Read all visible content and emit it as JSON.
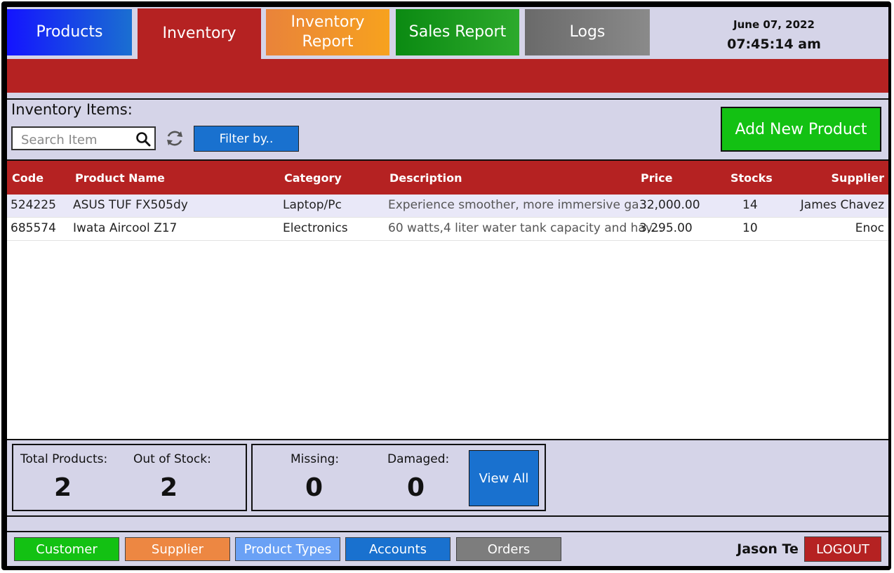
{
  "tabs": [
    {
      "label": "Products"
    },
    {
      "label": "Inventory"
    },
    {
      "label_line1": "Inventory",
      "label_line2": "Report"
    },
    {
      "label": "Sales Report"
    },
    {
      "label": "Logs"
    }
  ],
  "active_tab": "Inventory",
  "clock": {
    "date": "June 07, 2022",
    "time": "07:45:14 am"
  },
  "inventory": {
    "title": "Inventory Items:",
    "search_placeholder": "Search Item",
    "filter_label": "Filter by..",
    "add_label": "Add New Product"
  },
  "table": {
    "columns": [
      "Code",
      "Product Name",
      "Category",
      "Description",
      "Price",
      "Stocks",
      "Supplier"
    ],
    "rows": [
      [
        "524225",
        "ASUS TUF FX505dy",
        "Laptop/Pc",
        "Experience smoother, more immersive ga...",
        "32,000.00",
        "14",
        "James Chavez"
      ],
      [
        "685574",
        "Iwata Aircool Z17",
        "Electronics",
        "60 watts,4 liter water tank capacity and hav...",
        "3,295.00",
        "10",
        "Enoc"
      ]
    ]
  },
  "stats": {
    "total_products_label": "Total Products:",
    "total_products": "2",
    "out_of_stock_label": "Out of Stock:",
    "out_of_stock": "2",
    "missing_label": "Missing:",
    "missing": "0",
    "damaged_label": "Damaged:",
    "damaged": "0",
    "view_all_label": "View All"
  },
  "footer": {
    "buttons": [
      "Customer",
      "Supplier",
      "Product Types",
      "Accounts",
      "Orders"
    ],
    "user": "Jason Te",
    "logout": "LOGOUT"
  },
  "colors": {
    "accent_red": "#b52222",
    "panel_bg": "#d5d4e8",
    "button_blue": "#1971cf",
    "button_green": "#13c113"
  },
  "icons": [
    "search-icon",
    "refresh-icon"
  ]
}
